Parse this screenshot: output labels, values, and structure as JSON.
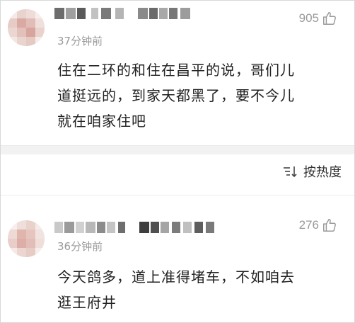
{
  "comments": [
    {
      "time": "37分钟前",
      "likes": "905",
      "text": "住在二环的和住在昌平的说，哥们儿\n道挺远的，到家天都黑了，要不今儿\n就在咱家住吧"
    },
    {
      "time": "36分钟前",
      "likes": "276",
      "text": "今天鸽多，道上准得堵车，不如咱去\n逛王府井"
    }
  ],
  "sort": {
    "label": "按热度"
  },
  "icons": {
    "like": "thumbs-up-icon",
    "sort": "sort-icon"
  },
  "colors": {
    "meta_text": "#9a9a9a",
    "body_text": "#222222",
    "divider": "#f2f2f2"
  }
}
